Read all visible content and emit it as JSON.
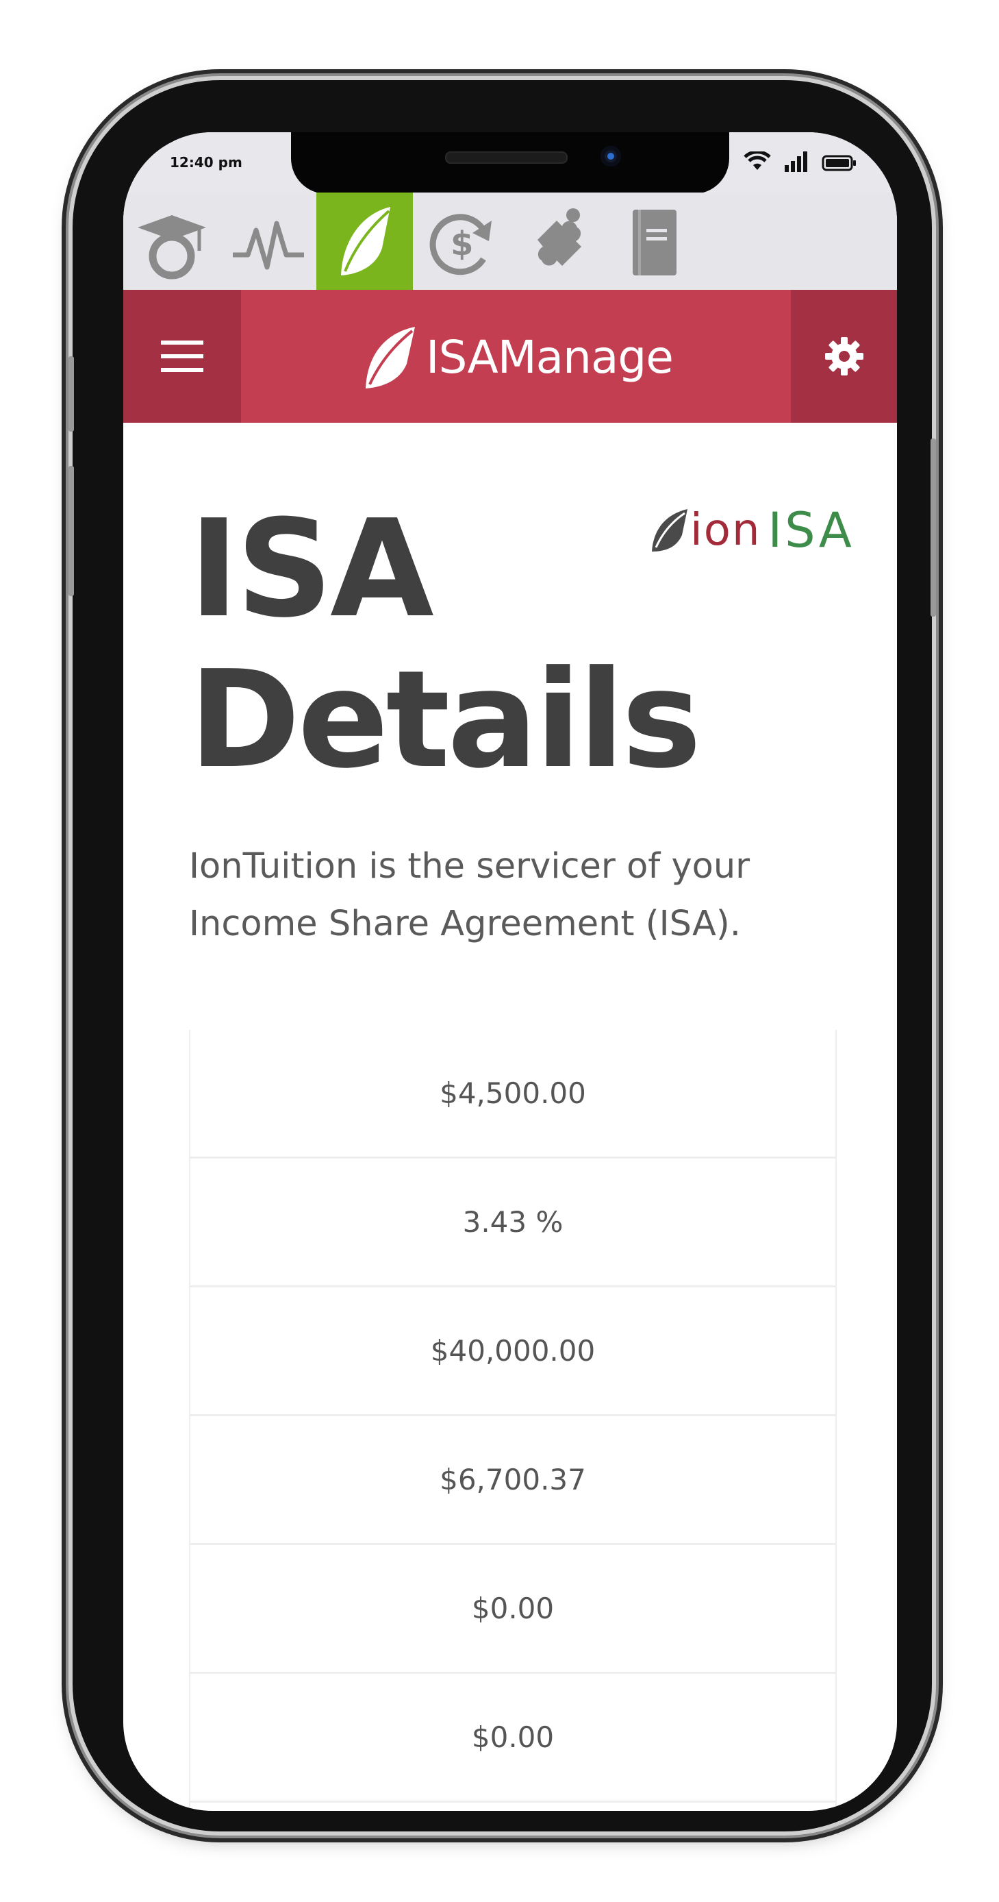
{
  "status_bar": {
    "time": "12:40 pm"
  },
  "app_tabs": [
    {
      "icon": "graduation-cap-icon",
      "active": false
    },
    {
      "icon": "pulse-icon",
      "active": false
    },
    {
      "icon": "isamanage-leaf-icon",
      "active": true
    },
    {
      "icon": "dollar-refresh-icon",
      "active": false
    },
    {
      "icon": "puzzle-piece-icon",
      "active": false
    },
    {
      "icon": "document-icon",
      "active": false
    }
  ],
  "header": {
    "brand": "ISAManage",
    "menu_icon": "hamburger-menu-icon",
    "settings_icon": "gear-icon"
  },
  "partner_logo": {
    "ion": "ion",
    "isa": "ISA"
  },
  "main": {
    "title": "ISA Details",
    "subtitle": "IonTuition is the servicer of your Income Share Agreement (ISA).",
    "rows": [
      "$4,500.00",
      "3.43 %",
      "$40,000.00",
      "$6,700.37",
      "$0.00",
      "$0.00"
    ]
  },
  "colors": {
    "header": "#c23e50",
    "header_dark": "#a43143",
    "active_tab": "#7ab51d",
    "tab_bar": "#e6e5ea",
    "logo_red": "#a32b39",
    "logo_green": "#3d8c4a"
  }
}
